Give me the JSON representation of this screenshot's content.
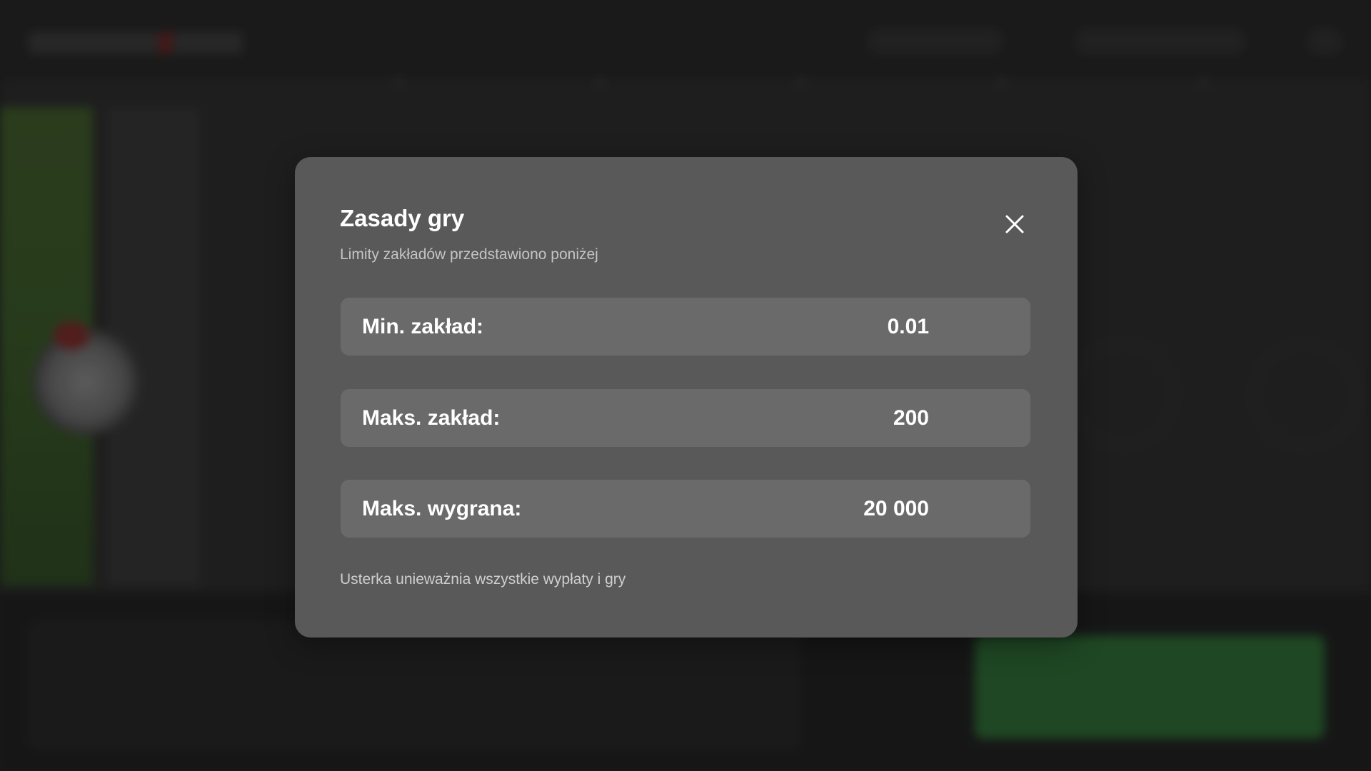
{
  "modal": {
    "title": "Zasady gry",
    "subtitle": "Limity zakładów przedstawiono poniżej",
    "close_icon": "close-icon",
    "limits": [
      {
        "label": "Min. zakład:",
        "value": "0.01"
      },
      {
        "label": "Maks. zakład:",
        "value": "200"
      },
      {
        "label": "Maks. wygrana:",
        "value": "20 000"
      }
    ],
    "footer_note": "Usterka unieważnia wszystkie wypłaty i gry"
  },
  "colors": {
    "modal_background": "#595959",
    "row_background": "#6a6a6a",
    "page_background": "#232323",
    "play_button_background": "#2c6b34"
  }
}
